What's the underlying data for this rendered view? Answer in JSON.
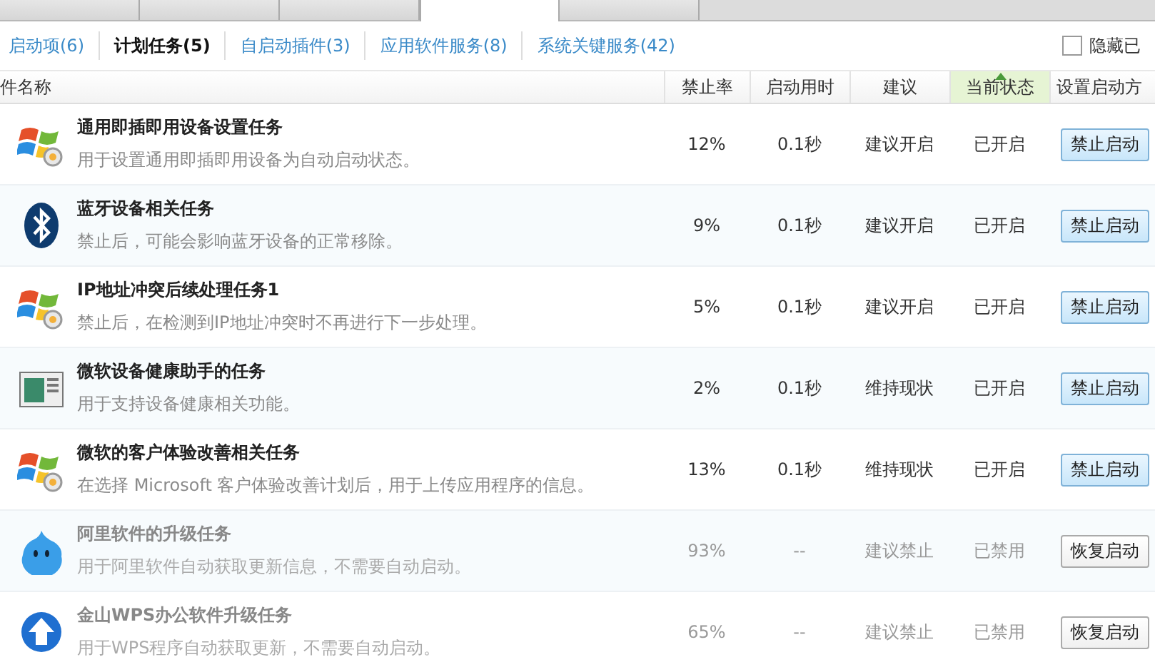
{
  "top_tabs": [
    {
      "selected": false
    },
    {
      "selected": false
    },
    {
      "selected": false
    },
    {
      "selected": true
    },
    {
      "selected": false
    }
  ],
  "sub_tabs": [
    {
      "label": "启动项(6)",
      "selected": false
    },
    {
      "label": "计划任务(5)",
      "selected": true
    },
    {
      "label": "自启动插件(3)",
      "selected": false
    },
    {
      "label": "应用软件服务(8)",
      "selected": false
    },
    {
      "label": "系统关键服务(42)",
      "selected": false
    }
  ],
  "hide_checkbox": {
    "label": "隐藏已",
    "checked": false
  },
  "table": {
    "columns": [
      {
        "label": "件名称",
        "sorted": false
      },
      {
        "label": "禁止率",
        "sorted": false
      },
      {
        "label": "启动用时",
        "sorted": false
      },
      {
        "label": "建议",
        "sorted": false
      },
      {
        "label": "当前状态",
        "sorted": true
      },
      {
        "label": "设置启动方",
        "sorted": false
      }
    ],
    "rows": [
      {
        "kind": "windows",
        "name": "通用即插即用设备设置任务",
        "description": "用于设置通用即插即用设备为自动启动状态。",
        "rate": "12%",
        "time": "0.1秒",
        "advice": "建议开启",
        "state": "已开启",
        "action": "禁止启动",
        "disabled": false
      },
      {
        "kind": "bluetooth",
        "name": "蓝牙设备相关任务",
        "description": "禁止后，可能会影响蓝牙设备的正常移除。",
        "rate": "9%",
        "time": "0.1秒",
        "advice": "建议开启",
        "state": "已开启",
        "action": "禁止启动",
        "disabled": false
      },
      {
        "kind": "windows",
        "name": "IP地址冲突后续处理任务1",
        "description": "禁止后，在检测到IP地址冲突时不再进行下一步处理。",
        "rate": "5%",
        "time": "0.1秒",
        "advice": "建议开启",
        "state": "已开启",
        "action": "禁止启动",
        "disabled": false
      },
      {
        "kind": "window",
        "name": "微软设备健康助手的任务",
        "description": "用于支持设备健康相关功能。",
        "rate": "2%",
        "time": "0.1秒",
        "advice": "维持现状",
        "state": "已开启",
        "action": "禁止启动",
        "disabled": false
      },
      {
        "kind": "windows",
        "name": "微软的客户体验改善相关任务",
        "description": "在选择 Microsoft 客户体验改善计划后，用于上传应用程序的信息。",
        "rate": "13%",
        "time": "0.1秒",
        "advice": "维持现状",
        "state": "已开启",
        "action": "禁止启动",
        "disabled": false
      },
      {
        "kind": "bubble",
        "name": "阿里软件的升级任务",
        "description": "用于阿里软件自动获取更新信息，不需要自动启动。",
        "rate": "93%",
        "time": "--",
        "advice": "建议禁止",
        "state": "已禁用",
        "action": "恢复启动",
        "disabled": true
      },
      {
        "kind": "upload",
        "name": "金山WPS办公软件升级任务",
        "description": "用于WPS程序自动获取更新，不需要自动启动。",
        "rate": "65%",
        "time": "--",
        "advice": "建议禁止",
        "state": "已禁用",
        "action": "恢复启动",
        "disabled": true
      }
    ]
  }
}
